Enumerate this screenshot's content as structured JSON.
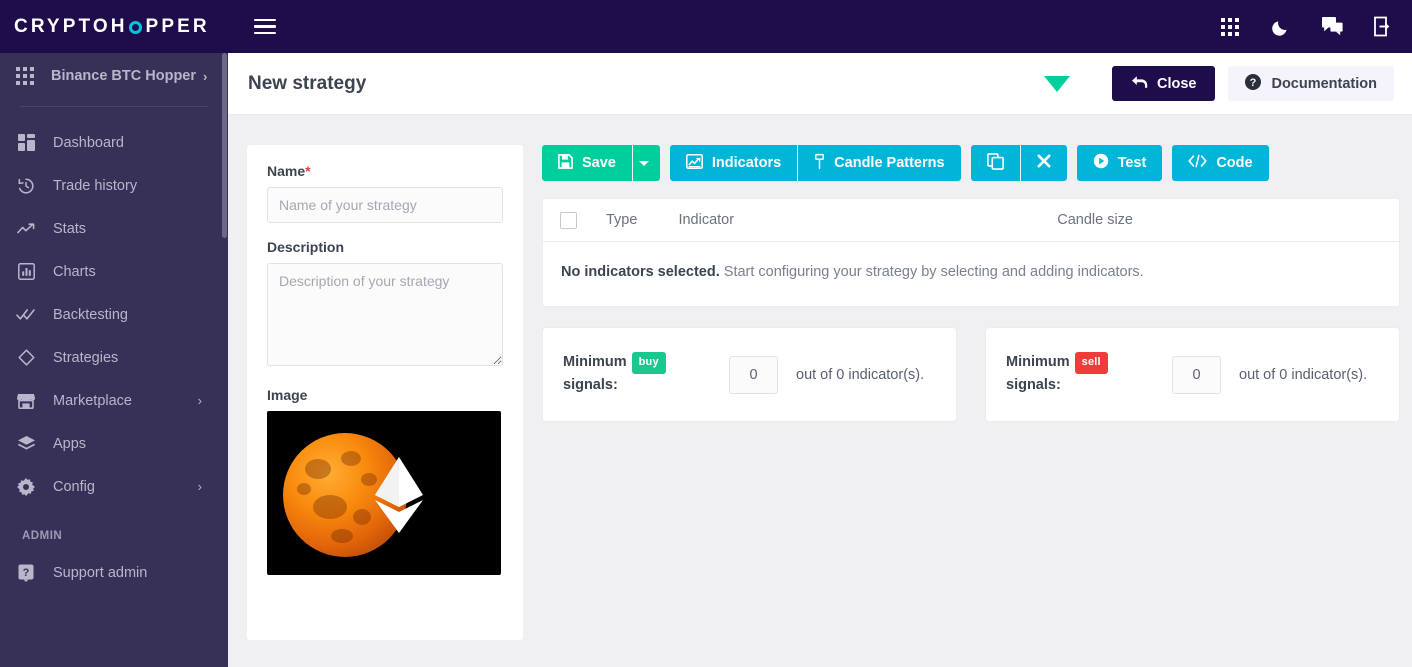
{
  "topbar": {
    "logo_part1": "CRYPTOH",
    "logo_part2": "PPER",
    "menu_icon": "hamburger-icon",
    "icons": [
      {
        "name": "apps-grid-icon",
        "label": "Apps"
      },
      {
        "name": "moon-icon",
        "label": "Dark mode"
      },
      {
        "name": "chat-icon",
        "label": "Chat"
      },
      {
        "name": "sign-out-icon",
        "label": "Sign out"
      }
    ]
  },
  "sidebar": {
    "hopper": {
      "label": "Binance BTC Hopper",
      "chevron": "›"
    },
    "items": [
      {
        "label": "Dashboard",
        "icon": "dashboard-icon",
        "chevron": ""
      },
      {
        "label": "Trade history",
        "icon": "history-icon",
        "chevron": ""
      },
      {
        "label": "Stats",
        "icon": "trending-icon",
        "chevron": ""
      },
      {
        "label": "Charts",
        "icon": "bar-chart-icon",
        "chevron": ""
      },
      {
        "label": "Backtesting",
        "icon": "double-check-icon",
        "chevron": ""
      },
      {
        "label": "Strategies",
        "icon": "diamond-icon",
        "chevron": ""
      },
      {
        "label": "Marketplace",
        "icon": "store-icon",
        "chevron": "›"
      },
      {
        "label": "Apps",
        "icon": "layers-icon",
        "chevron": ""
      },
      {
        "label": "Config",
        "icon": "gear-icon",
        "chevron": "›"
      }
    ],
    "admin_section": "ADMIN",
    "admin_items": [
      {
        "label": "Support admin",
        "icon": "help-badge-icon"
      }
    ]
  },
  "header": {
    "title": "New strategy",
    "signal_icon": "signal-strength-icon",
    "close_label": "Close",
    "documentation_label": "Documentation"
  },
  "form": {
    "name_label": "Name",
    "name_required": "*",
    "name_value": "",
    "name_placeholder": "Name of your strategy",
    "description_label": "Description",
    "description_value": "",
    "description_placeholder": "Description of your strategy",
    "image_label": "Image",
    "image_alt": "Orange lunar eclipse moon with white Ethereum logo"
  },
  "toolbar": {
    "save_label": "Save",
    "save_icon": "floppy-disk-icon",
    "save_caret_icon": "caret-down-icon",
    "indicators_label": "Indicators",
    "indicators_icon": "line-chart-icon",
    "candle_patterns_label": "Candle Patterns",
    "candle_patterns_icon": "candlestick-icon",
    "copy_icon": "copy-icon",
    "clear_icon": "close-x-icon",
    "test_label": "Test",
    "test_icon": "play-circle-icon",
    "code_label": "Code",
    "code_icon": "code-brackets-icon"
  },
  "indicators_table": {
    "columns": [
      "Type",
      "Indicator",
      "Candle size"
    ],
    "select_all_checked": false,
    "empty_state_bold": "No indicators selected.",
    "empty_state_rest": " Start configuring your strategy by selecting and adding indicators.",
    "rows": []
  },
  "signals": {
    "buy": {
      "label_line1": "Minimum",
      "label_line2": "signals:",
      "badge": "buy",
      "value": "0",
      "suffix": "out of 0 indicator(s)."
    },
    "sell": {
      "label_line1": "Minimum",
      "label_line2": "signals:",
      "badge": "sell",
      "value": "0",
      "suffix": "out of 0 indicator(s)."
    }
  },
  "colors": {
    "brand_dark": "#1e0d4a",
    "sidebar": "#383157",
    "accent_cyan": "#00c4e0",
    "green": "#00cf9d",
    "blue": "#00b5d8",
    "buy": "#17c98f",
    "sell": "#f23c3c",
    "required": "#f03e3e"
  }
}
